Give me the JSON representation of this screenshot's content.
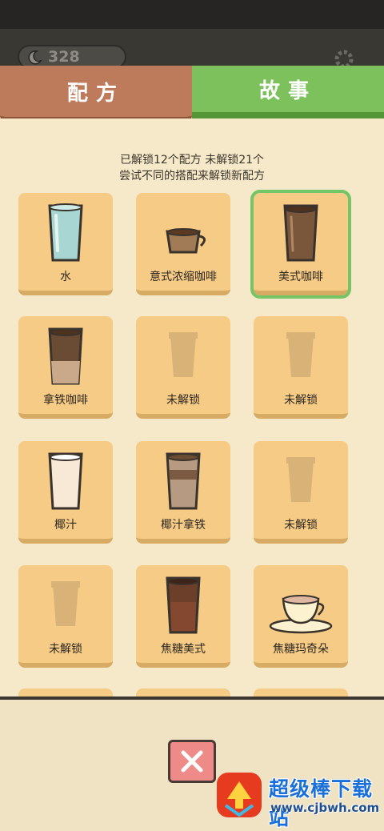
{
  "topbar": {
    "coins": "328",
    "moon_icon": "moon-icon",
    "gear_icon": "gear-icon"
  },
  "tabs": [
    {
      "label": "配方",
      "color": "#bd7b5c"
    },
    {
      "label": "故事",
      "color": "#7cc15b"
    }
  ],
  "summary": {
    "line1": "已解锁12个配方 未解锁21个",
    "line2": "尝试不同的搭配来解锁新配方"
  },
  "recipes": [
    {
      "label": "水",
      "icon": "water-glass-icon"
    },
    {
      "label": "意式浓缩咖啡",
      "icon": "espresso-cup-icon"
    },
    {
      "label": "美式咖啡",
      "icon": "americano-glass-icon",
      "selected": true
    },
    {
      "label": "拿铁咖啡",
      "icon": "latte-glass-icon"
    },
    {
      "label": "未解锁",
      "icon": "locked-cup-icon"
    },
    {
      "label": "未解锁",
      "icon": "locked-cup-icon"
    },
    {
      "label": "椰汁",
      "icon": "coconut-milk-glass-icon"
    },
    {
      "label": "椰汁拿铁",
      "icon": "coconut-latte-glass-icon"
    },
    {
      "label": "未解锁",
      "icon": "locked-cup-icon"
    },
    {
      "label": "未解锁",
      "icon": "locked-cup-icon"
    },
    {
      "label": "焦糖美式",
      "icon": "caramel-americano-glass-icon"
    },
    {
      "label": "焦糖玛奇朵",
      "icon": "caramel-macchiato-cup-icon"
    }
  ],
  "close_button": {
    "icon": "close-icon",
    "color": "#ee8b89"
  },
  "watermark": {
    "title": "超级棒下载站",
    "url": "www.cjbwh.com"
  }
}
